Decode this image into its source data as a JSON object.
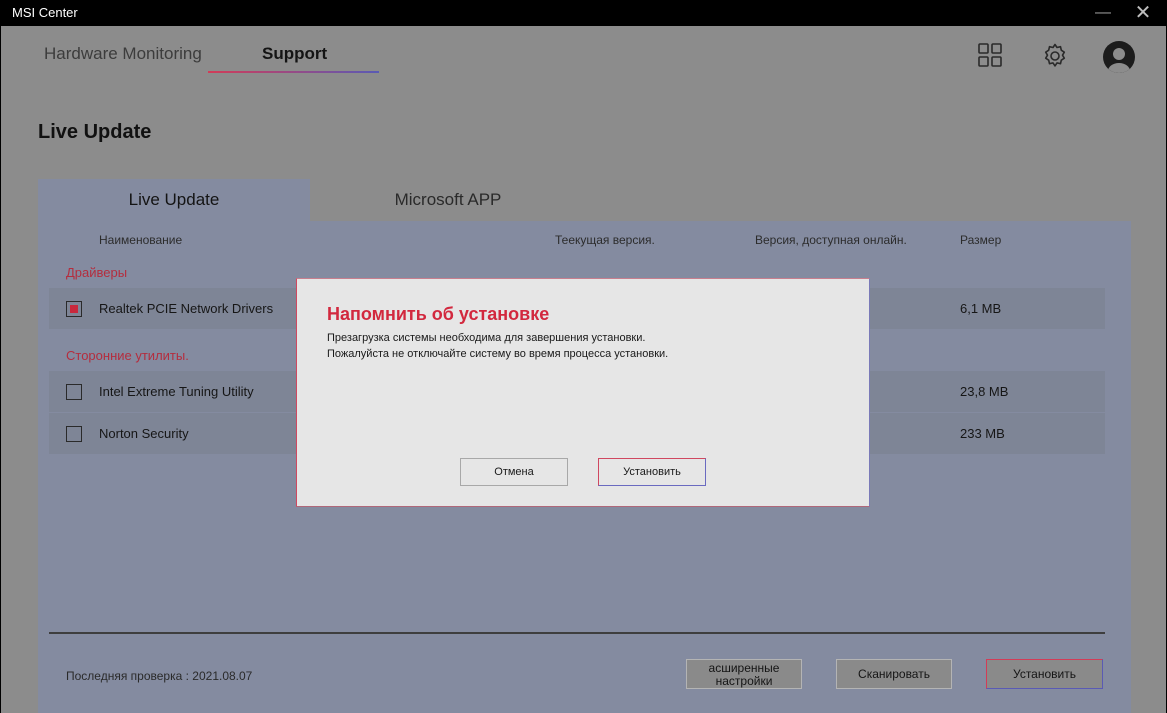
{
  "window": {
    "title": "MSI Center",
    "minimize_glyph": "—",
    "close_glyph": "✕"
  },
  "nav": {
    "tabs": [
      {
        "label": "Hardware Monitoring",
        "active": false
      },
      {
        "label": "Support",
        "active": true
      }
    ],
    "icons": [
      "grid-icon",
      "gear-icon",
      "avatar"
    ]
  },
  "page": {
    "title": "Live Update",
    "tabs": [
      {
        "label": "Live Update",
        "active": true
      },
      {
        "label": "Microsoft APP",
        "active": false
      }
    ]
  },
  "table": {
    "columns": [
      "Наименование",
      "Теекущая версия.",
      "Версия, доступная онлайн.",
      "Размер"
    ],
    "sections": [
      {
        "label": "Драйверы",
        "rows": [
          {
            "name": "Realtek PCIE Network Drivers",
            "size": "6,1 MB",
            "checked": true
          }
        ]
      },
      {
        "label": "Сторонние утилиты.",
        "rows": [
          {
            "name": "Intel Extreme Tuning Utility",
            "size": "23,8 MB",
            "checked": false
          },
          {
            "name": "Norton Security",
            "size": "233 MB",
            "checked": false
          }
        ]
      }
    ]
  },
  "footer": {
    "last_check": "Последняя проверка : 2021.08.07",
    "advanced_label": "асширенные настройки",
    "scan_label": "Сканировать",
    "install_label": "Установить"
  },
  "dialog": {
    "title": "Напомнить об установке",
    "line1": "Презагрузка системы необходима для завершения установки.",
    "line2": "Пожалуйста не отключайте систему во время процесса установки.",
    "cancel_label": "Отмена",
    "confirm_label": "Установить"
  },
  "colors": {
    "accent_red": "#d2283e",
    "accent_blue": "#5a5ab4",
    "panel": "#848ba0",
    "background": "#8c8c8c"
  }
}
